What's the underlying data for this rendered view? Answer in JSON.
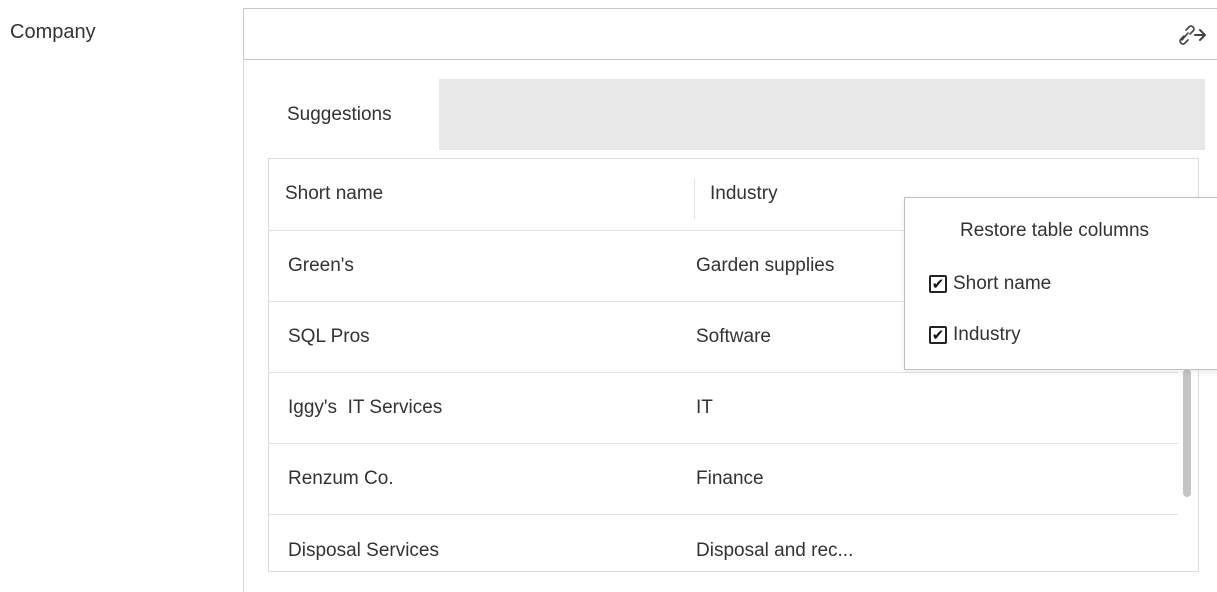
{
  "form": {
    "company_label": "Company",
    "company_value": ""
  },
  "icons": {
    "link": "link-arrow-icon",
    "checkmark": "✔"
  },
  "suggestions": {
    "tab_label": "Suggestions",
    "columns": [
      "Short name",
      "Industry"
    ],
    "rows": [
      {
        "short_name": "Green's",
        "industry": "Garden supplies"
      },
      {
        "short_name": "SQL Pros",
        "industry": "Software"
      },
      {
        "short_name": "Iggy's  IT Services",
        "industry": "IT"
      },
      {
        "short_name": "Renzum Co.",
        "industry": "Finance"
      },
      {
        "short_name": "Disposal Services",
        "industry": "Disposal and rec..."
      }
    ]
  },
  "column_menu": {
    "title": "Restore table columns",
    "options": [
      {
        "label": "Short name",
        "checked": true
      },
      {
        "label": "Industry",
        "checked": true
      }
    ]
  }
}
